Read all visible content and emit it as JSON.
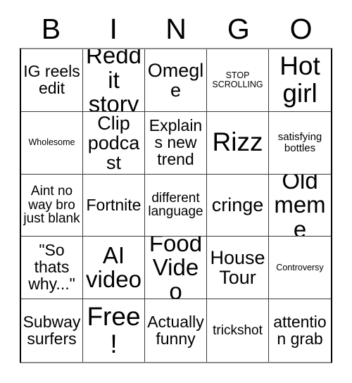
{
  "card": {
    "title_letters": [
      "B",
      "I",
      "N",
      "G",
      "O"
    ],
    "colors": {
      "background": "#ffffff",
      "text": "#000000",
      "grid_line": "#3a3a3a",
      "outer_border_side": "#000000",
      "outer_border_shadow": "#8c8c8c"
    },
    "rows": [
      [
        {
          "text": "IG reels edit",
          "size": "md"
        },
        {
          "text": "Reddit story",
          "size": "xl"
        },
        {
          "text": "Omegle",
          "size": "lg"
        },
        {
          "text": "STOP SCROLLING",
          "size": "xxs"
        },
        {
          "text": "Hot girl",
          "size": "xxl"
        }
      ],
      [
        {
          "text": "Wholesome",
          "size": "xxs"
        },
        {
          "text": "Clip podcast",
          "size": "lg"
        },
        {
          "text": "Explains new trend",
          "size": "md"
        },
        {
          "text": "Rizz",
          "size": "xxl"
        },
        {
          "text": "satisfying bottles",
          "size": "xs"
        }
      ],
      [
        {
          "text": "Aint no way bro just blank",
          "size": "sm"
        },
        {
          "text": "Fortnite",
          "size": "md"
        },
        {
          "text": "different language",
          "size": "sm"
        },
        {
          "text": "cringe",
          "size": "lg"
        },
        {
          "text": "Old meme",
          "size": "xl"
        }
      ],
      [
        {
          "text": "\"So thats why...\"",
          "size": "md"
        },
        {
          "text": "AI video",
          "size": "xl"
        },
        {
          "text": "Food Video",
          "size": "xl"
        },
        {
          "text": "House Tour",
          "size": "lg"
        },
        {
          "text": "Controversy",
          "size": "xxs"
        }
      ],
      [
        {
          "text": "Subway surfers",
          "size": "md"
        },
        {
          "text": "Free!",
          "size": "xxl"
        },
        {
          "text": "Actually funny",
          "size": "md"
        },
        {
          "text": "trickshot",
          "size": "sm"
        },
        {
          "text": "attention grab",
          "size": "md"
        }
      ]
    ]
  }
}
